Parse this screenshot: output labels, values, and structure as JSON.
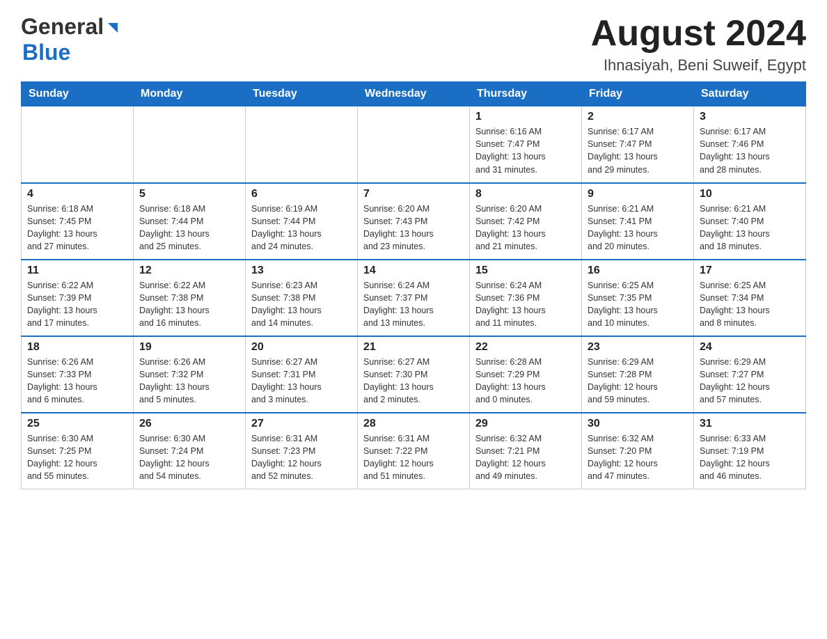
{
  "header": {
    "logo_general": "General",
    "logo_blue": "Blue",
    "month_title": "August 2024",
    "location": "Ihnasiyah, Beni Suweif, Egypt"
  },
  "days_of_week": [
    "Sunday",
    "Monday",
    "Tuesday",
    "Wednesday",
    "Thursday",
    "Friday",
    "Saturday"
  ],
  "weeks": [
    {
      "days": [
        {
          "num": "",
          "info": ""
        },
        {
          "num": "",
          "info": ""
        },
        {
          "num": "",
          "info": ""
        },
        {
          "num": "",
          "info": ""
        },
        {
          "num": "1",
          "info": "Sunrise: 6:16 AM\nSunset: 7:47 PM\nDaylight: 13 hours\nand 31 minutes."
        },
        {
          "num": "2",
          "info": "Sunrise: 6:17 AM\nSunset: 7:47 PM\nDaylight: 13 hours\nand 29 minutes."
        },
        {
          "num": "3",
          "info": "Sunrise: 6:17 AM\nSunset: 7:46 PM\nDaylight: 13 hours\nand 28 minutes."
        }
      ]
    },
    {
      "days": [
        {
          "num": "4",
          "info": "Sunrise: 6:18 AM\nSunset: 7:45 PM\nDaylight: 13 hours\nand 27 minutes."
        },
        {
          "num": "5",
          "info": "Sunrise: 6:18 AM\nSunset: 7:44 PM\nDaylight: 13 hours\nand 25 minutes."
        },
        {
          "num": "6",
          "info": "Sunrise: 6:19 AM\nSunset: 7:44 PM\nDaylight: 13 hours\nand 24 minutes."
        },
        {
          "num": "7",
          "info": "Sunrise: 6:20 AM\nSunset: 7:43 PM\nDaylight: 13 hours\nand 23 minutes."
        },
        {
          "num": "8",
          "info": "Sunrise: 6:20 AM\nSunset: 7:42 PM\nDaylight: 13 hours\nand 21 minutes."
        },
        {
          "num": "9",
          "info": "Sunrise: 6:21 AM\nSunset: 7:41 PM\nDaylight: 13 hours\nand 20 minutes."
        },
        {
          "num": "10",
          "info": "Sunrise: 6:21 AM\nSunset: 7:40 PM\nDaylight: 13 hours\nand 18 minutes."
        }
      ]
    },
    {
      "days": [
        {
          "num": "11",
          "info": "Sunrise: 6:22 AM\nSunset: 7:39 PM\nDaylight: 13 hours\nand 17 minutes."
        },
        {
          "num": "12",
          "info": "Sunrise: 6:22 AM\nSunset: 7:38 PM\nDaylight: 13 hours\nand 16 minutes."
        },
        {
          "num": "13",
          "info": "Sunrise: 6:23 AM\nSunset: 7:38 PM\nDaylight: 13 hours\nand 14 minutes."
        },
        {
          "num": "14",
          "info": "Sunrise: 6:24 AM\nSunset: 7:37 PM\nDaylight: 13 hours\nand 13 minutes."
        },
        {
          "num": "15",
          "info": "Sunrise: 6:24 AM\nSunset: 7:36 PM\nDaylight: 13 hours\nand 11 minutes."
        },
        {
          "num": "16",
          "info": "Sunrise: 6:25 AM\nSunset: 7:35 PM\nDaylight: 13 hours\nand 10 minutes."
        },
        {
          "num": "17",
          "info": "Sunrise: 6:25 AM\nSunset: 7:34 PM\nDaylight: 13 hours\nand 8 minutes."
        }
      ]
    },
    {
      "days": [
        {
          "num": "18",
          "info": "Sunrise: 6:26 AM\nSunset: 7:33 PM\nDaylight: 13 hours\nand 6 minutes."
        },
        {
          "num": "19",
          "info": "Sunrise: 6:26 AM\nSunset: 7:32 PM\nDaylight: 13 hours\nand 5 minutes."
        },
        {
          "num": "20",
          "info": "Sunrise: 6:27 AM\nSunset: 7:31 PM\nDaylight: 13 hours\nand 3 minutes."
        },
        {
          "num": "21",
          "info": "Sunrise: 6:27 AM\nSunset: 7:30 PM\nDaylight: 13 hours\nand 2 minutes."
        },
        {
          "num": "22",
          "info": "Sunrise: 6:28 AM\nSunset: 7:29 PM\nDaylight: 13 hours\nand 0 minutes."
        },
        {
          "num": "23",
          "info": "Sunrise: 6:29 AM\nSunset: 7:28 PM\nDaylight: 12 hours\nand 59 minutes."
        },
        {
          "num": "24",
          "info": "Sunrise: 6:29 AM\nSunset: 7:27 PM\nDaylight: 12 hours\nand 57 minutes."
        }
      ]
    },
    {
      "days": [
        {
          "num": "25",
          "info": "Sunrise: 6:30 AM\nSunset: 7:25 PM\nDaylight: 12 hours\nand 55 minutes."
        },
        {
          "num": "26",
          "info": "Sunrise: 6:30 AM\nSunset: 7:24 PM\nDaylight: 12 hours\nand 54 minutes."
        },
        {
          "num": "27",
          "info": "Sunrise: 6:31 AM\nSunset: 7:23 PM\nDaylight: 12 hours\nand 52 minutes."
        },
        {
          "num": "28",
          "info": "Sunrise: 6:31 AM\nSunset: 7:22 PM\nDaylight: 12 hours\nand 51 minutes."
        },
        {
          "num": "29",
          "info": "Sunrise: 6:32 AM\nSunset: 7:21 PM\nDaylight: 12 hours\nand 49 minutes."
        },
        {
          "num": "30",
          "info": "Sunrise: 6:32 AM\nSunset: 7:20 PM\nDaylight: 12 hours\nand 47 minutes."
        },
        {
          "num": "31",
          "info": "Sunrise: 6:33 AM\nSunset: 7:19 PM\nDaylight: 12 hours\nand 46 minutes."
        }
      ]
    }
  ]
}
